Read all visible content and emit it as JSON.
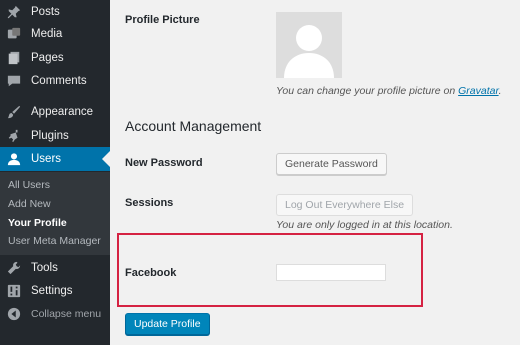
{
  "sidebar": {
    "items": [
      {
        "label": "Posts",
        "icon": "pushpin-icon"
      },
      {
        "label": "Media",
        "icon": "media-icon"
      },
      {
        "label": "Pages",
        "icon": "pages-icon"
      },
      {
        "label": "Comments",
        "icon": "comments-icon"
      },
      {
        "label": "Appearance",
        "icon": "paintbrush-icon"
      },
      {
        "label": "Plugins",
        "icon": "plugin-icon"
      },
      {
        "label": "Users",
        "icon": "users-icon"
      },
      {
        "label": "Tools",
        "icon": "wrench-icon"
      },
      {
        "label": "Settings",
        "icon": "settings-icon"
      }
    ],
    "submenu": [
      "All Users",
      "Add New",
      "Your Profile",
      "User Meta Manager"
    ],
    "collapse_label": "Collapse menu",
    "active_color": "#0073aa"
  },
  "profile_picture": {
    "label": "Profile Picture",
    "desc_prefix": "You can change your profile picture on ",
    "link_text": "Gravatar",
    "desc_suffix": "."
  },
  "account_management": {
    "title": "Account Management",
    "new_password_label": "New Password",
    "generate_button": "Generate Password",
    "sessions_label": "Sessions",
    "logout_button": "Log Out Everywhere Else",
    "sessions_desc": "You are only logged in at this location."
  },
  "facebook": {
    "label": "Facebook",
    "value": ""
  },
  "update_button": "Update Profile",
  "highlight_color": "#d52242"
}
